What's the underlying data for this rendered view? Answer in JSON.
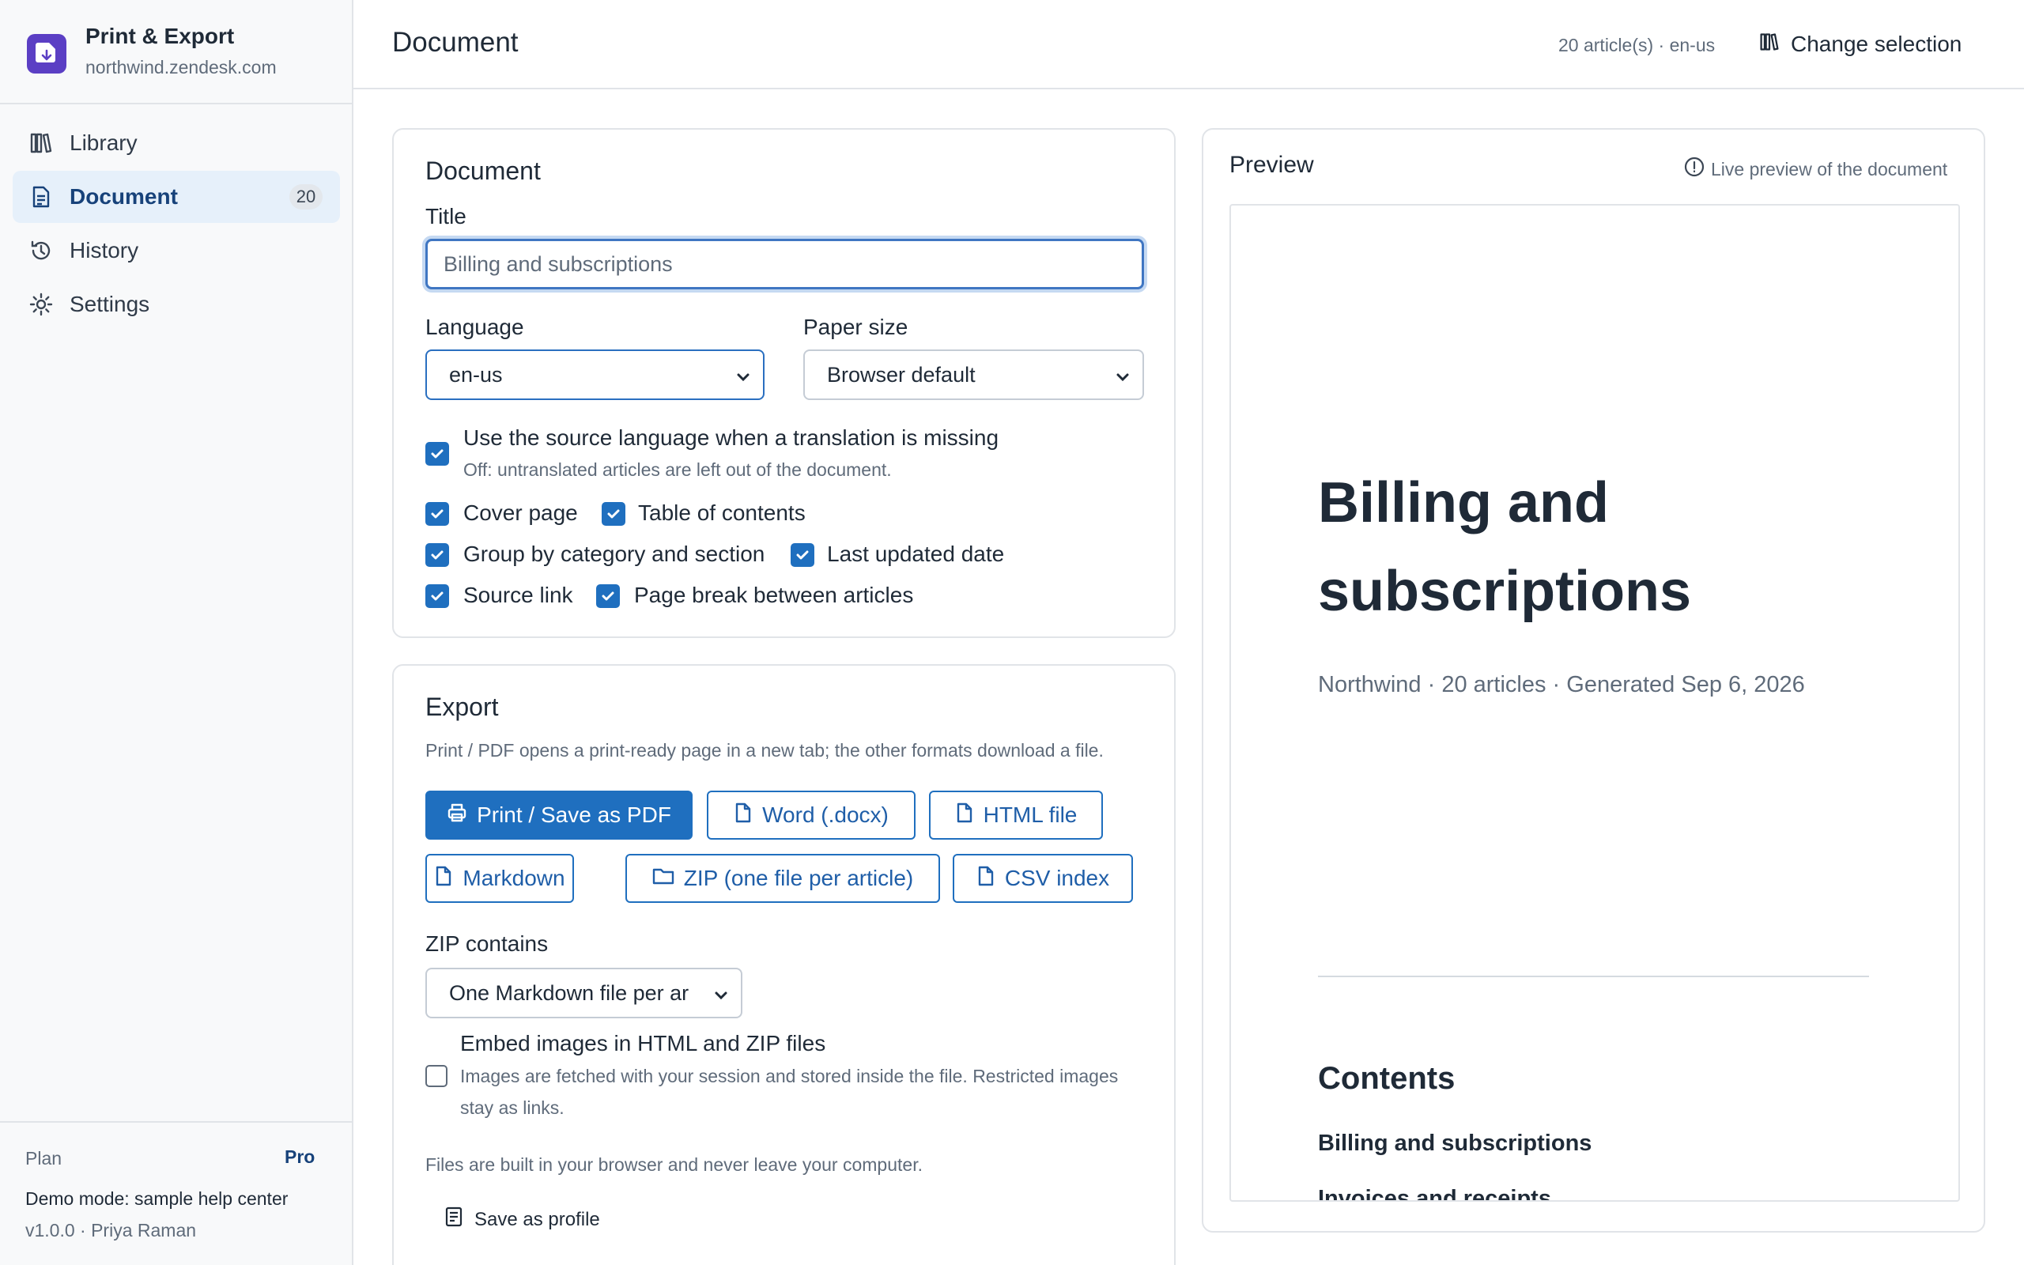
{
  "app": {
    "name": "Print & Export",
    "domain": "northwind.zendesk.com"
  },
  "sidebar": {
    "items": [
      {
        "label": "Library",
        "icon": "library-icon"
      },
      {
        "label": "Document",
        "icon": "document-icon",
        "badge": "20",
        "active": true
      },
      {
        "label": "History",
        "icon": "history-icon"
      },
      {
        "label": "Settings",
        "icon": "gear-icon"
      }
    ],
    "plan_label": "Plan",
    "plan_value": "Pro",
    "demo_mode": "Demo mode: sample help center",
    "version": "v1.0.0 · Priya Raman"
  },
  "header": {
    "title": "Document",
    "meta": "20 article(s) · en-us",
    "change_selection": "Change selection"
  },
  "document_card": {
    "title": "Document",
    "title_label": "Title",
    "title_placeholder": "Billing and subscriptions",
    "language_label": "Language",
    "language_value": "en-us",
    "paper_label": "Paper size",
    "paper_value": "Browser default",
    "source_lang": {
      "label": "Use the source language when a translation is missing",
      "help": "Off: untranslated articles are left out of the document.",
      "checked": true
    },
    "options": [
      {
        "label": "Cover page",
        "checked": true
      },
      {
        "label": "Table of contents",
        "checked": true
      },
      {
        "label": "Group by category and section",
        "checked": true
      },
      {
        "label": "Last updated date",
        "checked": true
      },
      {
        "label": "Source link",
        "checked": true
      },
      {
        "label": "Page break between articles",
        "checked": true
      }
    ]
  },
  "export_card": {
    "title": "Export",
    "description": "Print / PDF opens a print-ready page in a new tab; the other formats download a file.",
    "buttons": {
      "print": "Print / Save as PDF",
      "word": "Word (.docx)",
      "html": "HTML file",
      "markdown": "Markdown",
      "zip": "ZIP (one file per article)",
      "csv": "CSV index"
    },
    "zip_label": "ZIP contains",
    "zip_value": "One Markdown file per ar",
    "embed": {
      "label": "Embed images in HTML and ZIP files",
      "help1": "Images are fetched with your session and stored inside the file. Restricted images",
      "help2": "stay as links.",
      "checked": false
    },
    "footnote": "Files are built in your browser and never leave your computer.",
    "save_profile": "Save as profile"
  },
  "preview": {
    "title": "Preview",
    "hint": "Live preview of the document",
    "doc_title_line1": "Billing and",
    "doc_title_line2": "subscriptions",
    "doc_subtitle": "Northwind · 20 articles · Generated Sep 6, 2026",
    "contents": "Contents",
    "toc_1": "Billing and subscriptions",
    "toc_2": "Invoices and receipts"
  },
  "colors": {
    "accent": "#1f6fbf",
    "brand": "#5b3fc4",
    "active_nav_bg": "#e6f0fa"
  }
}
